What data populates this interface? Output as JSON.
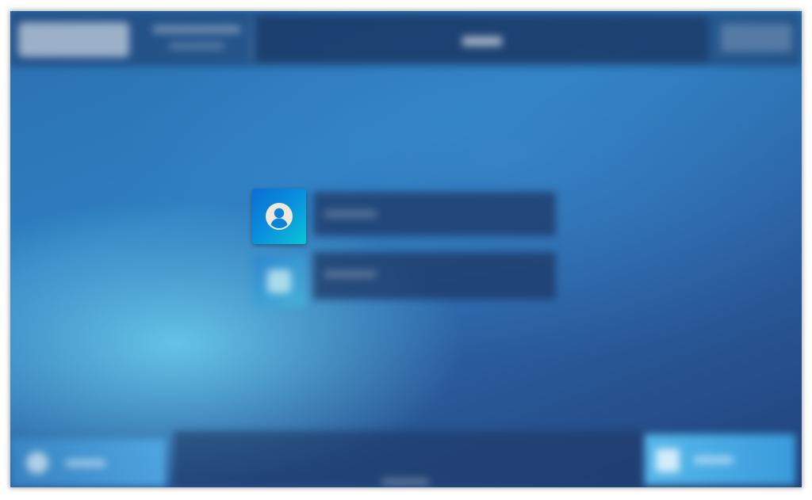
{
  "login": {
    "username_icon": "user-circle-icon",
    "password_icon": "lock-icon"
  },
  "colors": {
    "accent_start": "#0b6fd6",
    "accent_end": "#0bc6d8",
    "icon_fill": "#efe8dc"
  }
}
